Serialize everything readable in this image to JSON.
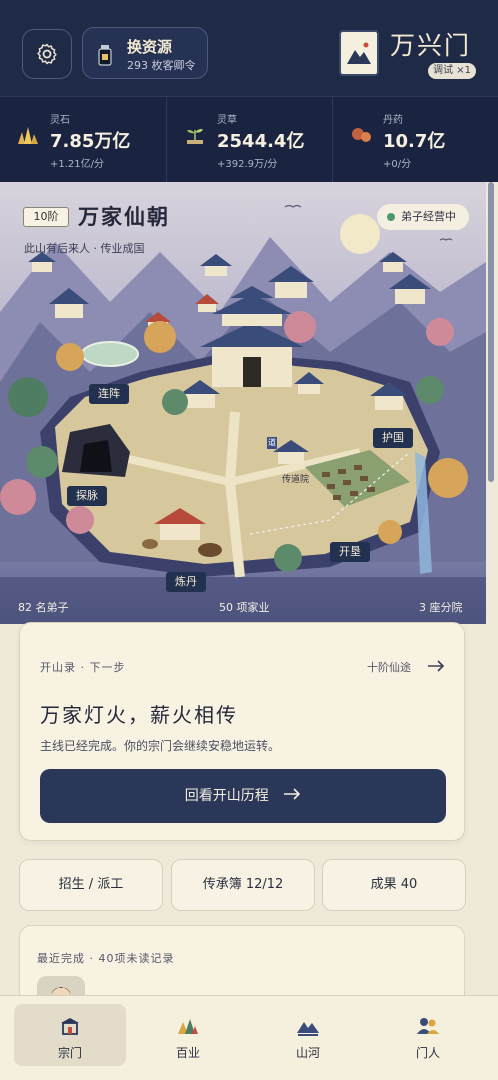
{
  "header": {
    "switch_title": "换资源",
    "switch_sub": "293 枚客卿令",
    "sect_name": "万兴门",
    "debug_chip": "调试 ×1"
  },
  "resources": [
    {
      "icon": "spirit-stone-icon",
      "name": "灵石",
      "value": "7.85万亿",
      "rate": "+1.21亿/分"
    },
    {
      "icon": "herb-icon",
      "name": "灵草",
      "value": "2544.4亿",
      "rate": "+392.9万/分"
    },
    {
      "icon": "pill-icon",
      "name": "丹药",
      "value": "10.7亿",
      "rate": "+0/分"
    }
  ],
  "map": {
    "tier": "10阶",
    "title": "万家仙朝",
    "subtitle": "此山有后来人 · 传业成国",
    "status": "弟子经营中",
    "labels": {
      "array": "连阵",
      "mine": "探脉",
      "alchemy": "炼丹",
      "guard": "护国",
      "farm": "开垦",
      "hall": "传道院",
      "sign": "道"
    },
    "stats": {
      "disciples": "82 名弟子",
      "industries": "50 项家业",
      "branches": "3 座分院"
    }
  },
  "quest": {
    "kicker": "开山录 · 下一步",
    "link": "十阶仙途",
    "title": "万家灯火，薪火相传",
    "desc": "主线已经完成。你的宗门会继续安稳地运转。",
    "button": "回看开山历程"
  },
  "actions": [
    {
      "label": "招生 / 派工"
    },
    {
      "label": "传承簿 12/12"
    },
    {
      "label": "成果 40"
    }
  ],
  "recent": {
    "title": "最近完成 · 40项未读记录"
  },
  "nav": [
    {
      "label": "宗门",
      "icon": "sect-icon"
    },
    {
      "label": "百业",
      "icon": "industry-icon"
    },
    {
      "label": "山河",
      "icon": "mountain-icon"
    },
    {
      "label": "门人",
      "icon": "people-icon"
    }
  ],
  "colors": {
    "header_bg": "#1f2a47",
    "accent": "#2a3759",
    "page_bg": "#efe9da",
    "status_green": "#4c9a6a"
  }
}
